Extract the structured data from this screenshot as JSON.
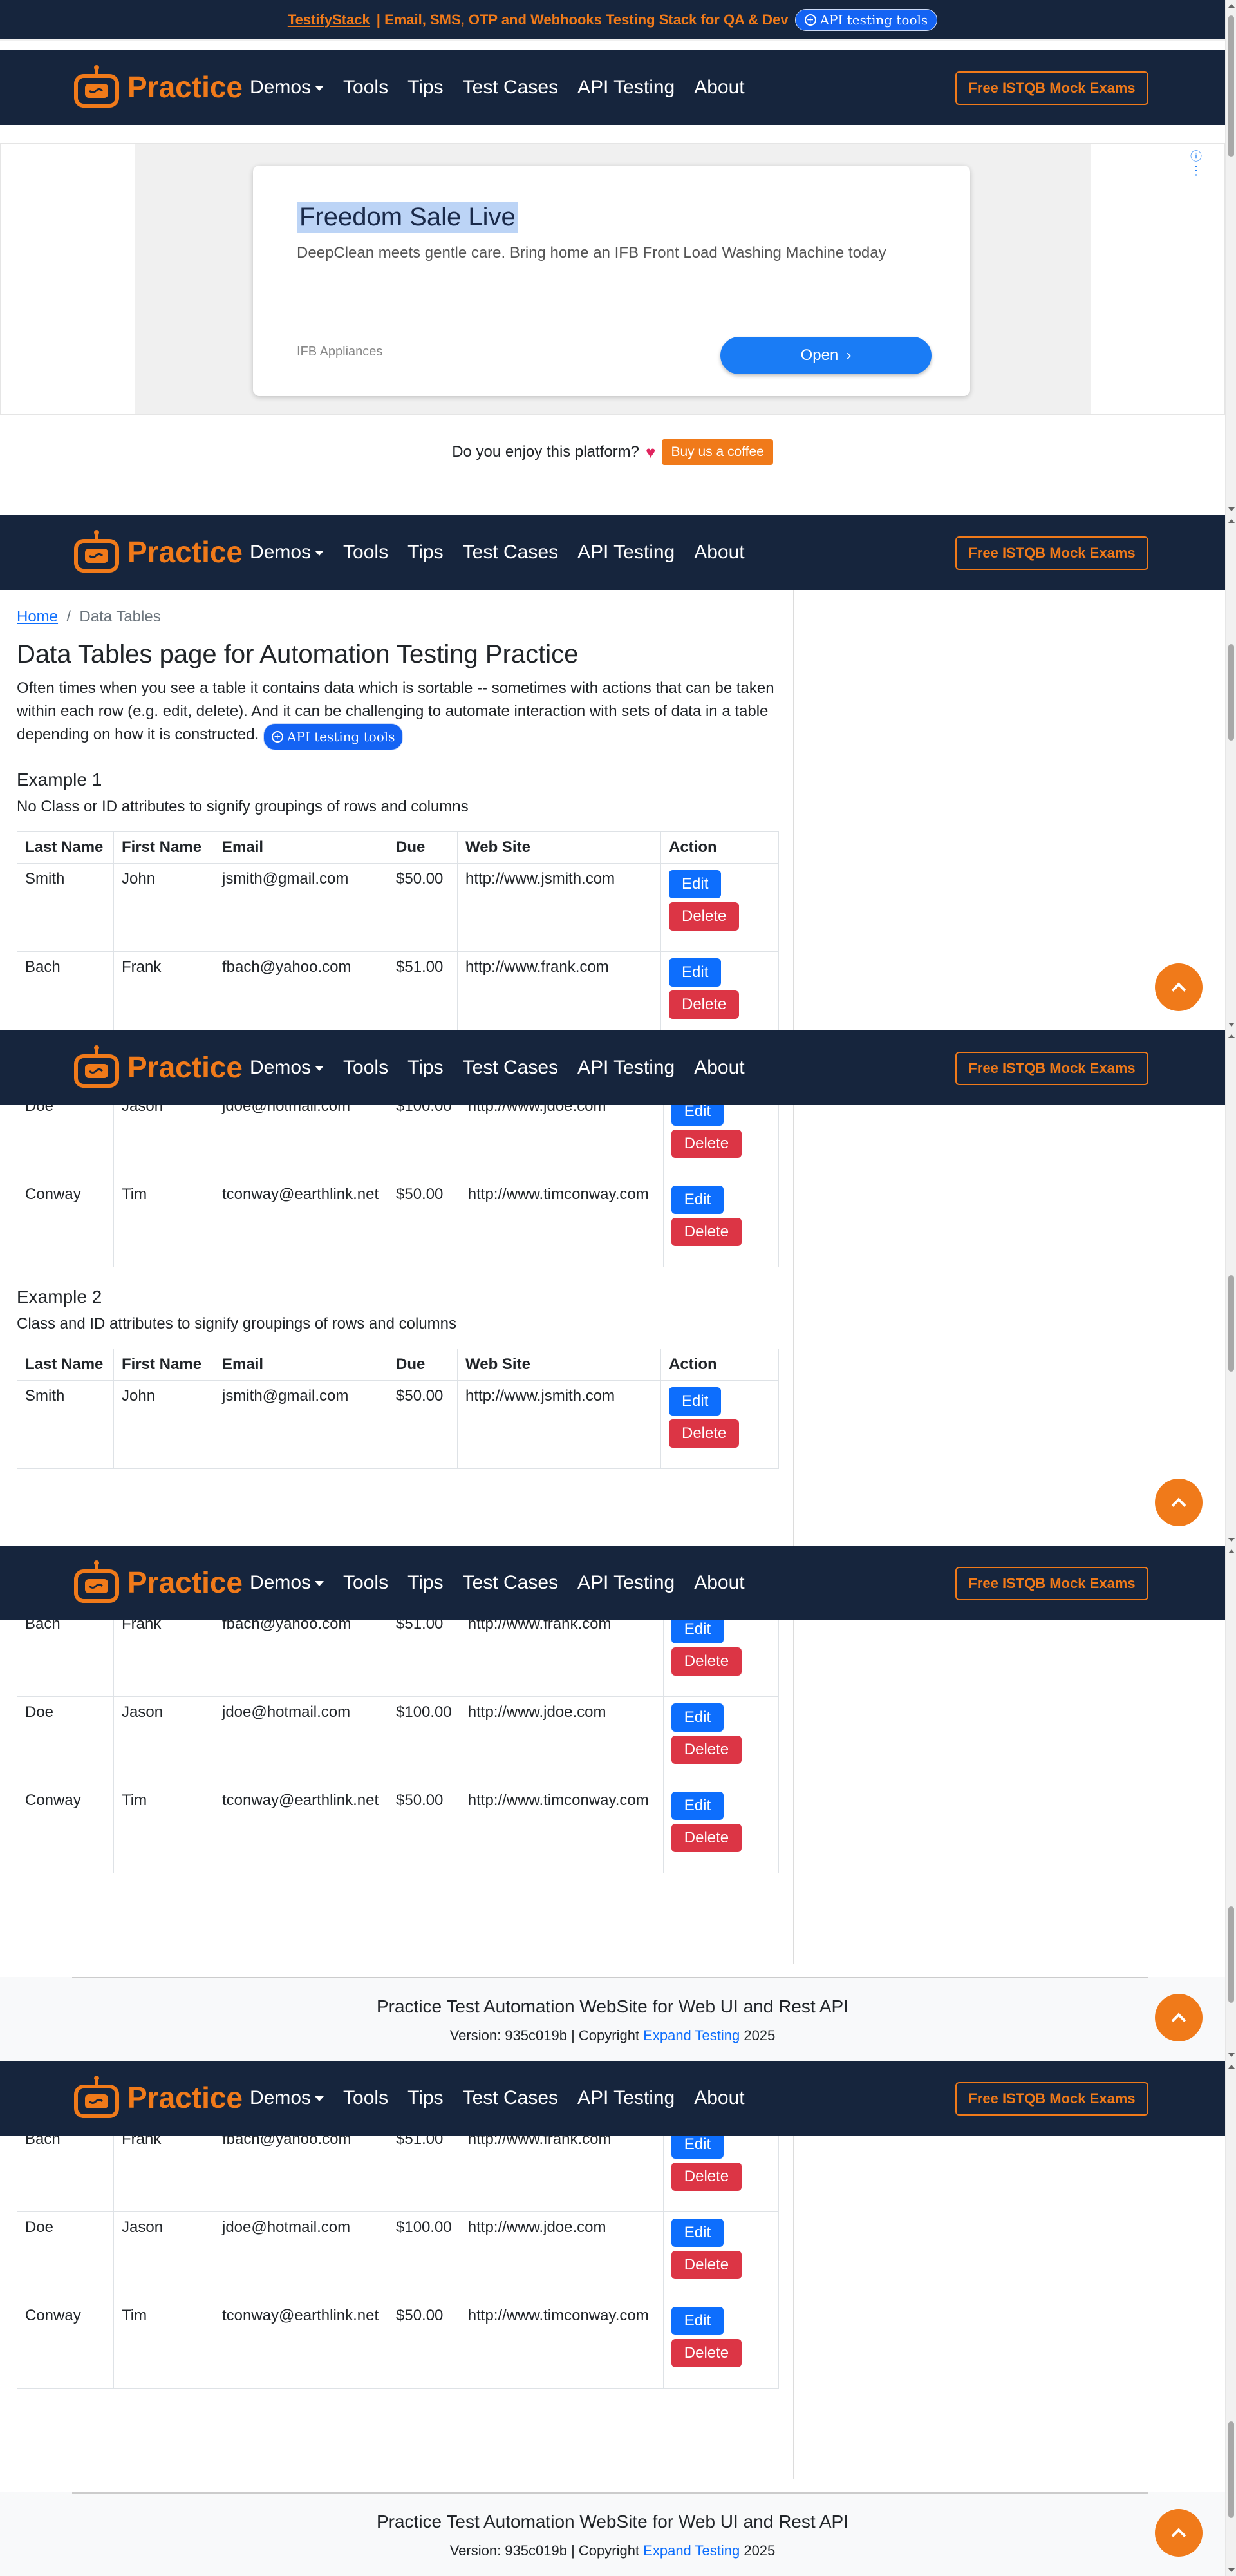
{
  "banner": {
    "brand": "TestifyStack",
    "text": " | Email, SMS, OTP and Webhooks Testing Stack for QA & Dev",
    "pill": "API testing tools"
  },
  "nav": {
    "brand": "Practice",
    "items": [
      "Demos",
      "Tools",
      "Tips",
      "Test Cases",
      "API Testing",
      "About"
    ],
    "cta": "Free ISTQB Mock Exams"
  },
  "ad": {
    "title": "Freedom Sale Live",
    "description": "DeepClean meets gentle care. Bring home an IFB Front Load Washing Machine today",
    "source": "IFB Appliances",
    "button": "Open"
  },
  "support": {
    "question": "Do you enjoy this platform?",
    "button": "Buy us a coffee"
  },
  "breadcrumb": {
    "home": "Home",
    "current": "Data Tables"
  },
  "page": {
    "title": "Data Tables page for Automation Testing Practice",
    "intro": "Often times when you see a table it contains data which is sortable -- sometimes with actions that can be taken within each row (e.g. edit, delete). And it can be challenging to automate interaction with sets of data in a table depending on how it is constructed.",
    "pill": "API testing tools"
  },
  "example1": {
    "title": "Example 1",
    "desc": "No Class or ID attributes to signify groupings of rows and columns"
  },
  "example2": {
    "title": "Example 2",
    "desc": "Class and ID attributes to signify groupings of rows and columns"
  },
  "table": {
    "headers": [
      "Last Name",
      "First Name",
      "Email",
      "Due",
      "Web Site",
      "Action"
    ],
    "rows": [
      [
        "Smith",
        "John",
        "jsmith@gmail.com",
        "$50.00",
        "http://www.jsmith.com"
      ],
      [
        "Bach",
        "Frank",
        "fbach@yahoo.com",
        "$51.00",
        "http://www.frank.com"
      ],
      [
        "Doe",
        "Jason",
        "jdoe@hotmail.com",
        "$100.00",
        "http://www.jdoe.com"
      ],
      [
        "Conway",
        "Tim",
        "tconway@earthlink.net",
        "$50.00",
        "http://www.timconway.com"
      ]
    ],
    "edit": "Edit",
    "delete": "Delete"
  },
  "footer": {
    "title": "Practice Test Automation WebSite for Web UI and Rest API",
    "version_prefix": "Version: 935c019b | Copyright ",
    "link": "Expand Testing",
    "year": " 2025"
  },
  "colors": {
    "navy": "#16253d",
    "orange": "#f07a1a",
    "primary": "#0d6efd",
    "danger": "#dc3545"
  }
}
